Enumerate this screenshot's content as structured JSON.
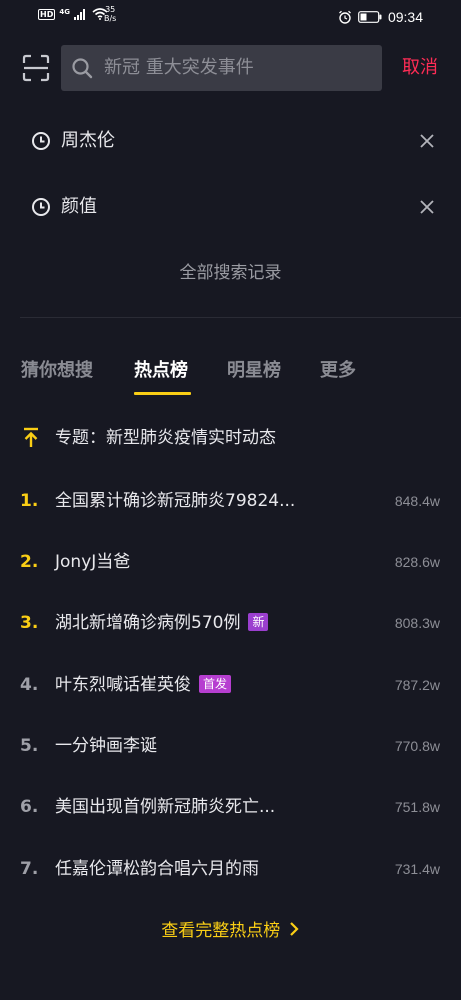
{
  "status_bar": {
    "hd": "HD",
    "network": "4G",
    "speed_value": "35",
    "speed_unit": "B/s",
    "time": "09:34"
  },
  "search": {
    "placeholder": "新冠 重大突发事件",
    "cancel_label": "取消"
  },
  "history": {
    "items": [
      {
        "label": "周杰伦"
      },
      {
        "label": "颜值"
      }
    ],
    "all_label": "全部搜索记录"
  },
  "tabs": [
    {
      "label": "猜你想搜",
      "active": false
    },
    {
      "label": "热点榜",
      "active": true
    },
    {
      "label": "明星榜",
      "active": false
    },
    {
      "label": "更多",
      "active": false
    }
  ],
  "topic": {
    "label": "专题：新型肺炎疫情实时动态"
  },
  "hot_list": [
    {
      "rank": "1.",
      "title": "全国累计确诊新冠肺炎79824...",
      "heat": "848.4w",
      "badge": ""
    },
    {
      "rank": "2.",
      "title": "JonyJ当爸",
      "heat": "828.6w",
      "badge": ""
    },
    {
      "rank": "3.",
      "title": "湖北新增确诊病例570例",
      "heat": "808.3w",
      "badge": "新"
    },
    {
      "rank": "4.",
      "title": "叶东烈喊话崔英俊",
      "heat": "787.2w",
      "badge": "首发"
    },
    {
      "rank": "5.",
      "title": "一分钟画李诞",
      "heat": "770.8w",
      "badge": ""
    },
    {
      "rank": "6.",
      "title": "美国出现首例新冠肺炎死亡...",
      "heat": "751.8w",
      "badge": ""
    },
    {
      "rank": "7.",
      "title": "任嘉伦谭松韵合唱六月的雨",
      "heat": "731.4w",
      "badge": ""
    }
  ],
  "full_list_label": "查看完整热点榜",
  "colors": {
    "background": "#171822",
    "accent_yellow": "#face15",
    "cancel_red": "#fe2c55",
    "badge_purple": "#b63ed0"
  }
}
